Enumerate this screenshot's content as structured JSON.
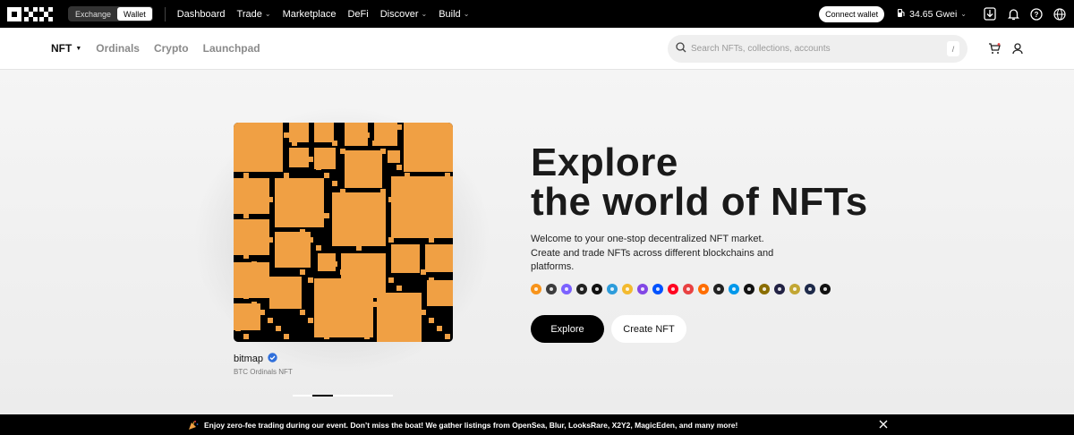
{
  "topbar": {
    "brand": "OKX",
    "mode_tabs": [
      "Exchange",
      "Wallet"
    ],
    "active_mode": "Wallet",
    "nav": [
      {
        "label": "Dashboard",
        "dropdown": false
      },
      {
        "label": "Trade",
        "dropdown": true
      },
      {
        "label": "Marketplace",
        "dropdown": false
      },
      {
        "label": "DeFi",
        "dropdown": false
      },
      {
        "label": "Discover",
        "dropdown": true
      },
      {
        "label": "Build",
        "dropdown": true
      }
    ],
    "connect_label": "Connect wallet",
    "gas_label": "34.65 Gwei",
    "icons": [
      "download-icon",
      "bell-icon",
      "help-icon",
      "globe-icon"
    ]
  },
  "subnav": {
    "tabs": [
      "NFT",
      "Ordinals",
      "Crypto",
      "Launchpad"
    ],
    "current": "NFT",
    "search_placeholder": "Search NFTs, collections, accounts",
    "search_shortcut": "/",
    "icons": [
      "cart-icon",
      "user-icon"
    ]
  },
  "hero": {
    "title_line1": "Explore",
    "title_line2": "the world of NFTs",
    "description": "Welcome to your one-stop decentralized NFT market. Create and trade NFTs across different blockchains and platforms.",
    "explore_label": "Explore",
    "create_label": "Create NFT",
    "collection_name": "bitmap",
    "collection_subtitle": "BTC Ordinals NFT",
    "verified": true,
    "art_colors": {
      "fill": "#f0a044",
      "grid": "#111111"
    },
    "carousel_count": 5,
    "carousel_active": 1,
    "chain_icons": [
      {
        "name": "bitcoin-icon",
        "color": "#f7931a"
      },
      {
        "name": "ethereum-icon",
        "color": "#3c3c3d"
      },
      {
        "name": "solana-icon",
        "color": "#7b61ff"
      },
      {
        "name": "okt-chain-icon",
        "color": "#222222"
      },
      {
        "name": "x-layer-icon",
        "color": "#111111"
      },
      {
        "name": "arbitrum-icon",
        "color": "#2d9cdb"
      },
      {
        "name": "bnb-chain-icon",
        "color": "#f3ba2f"
      },
      {
        "name": "polygon-icon",
        "color": "#8247e5"
      },
      {
        "name": "base-icon",
        "color": "#0052ff"
      },
      {
        "name": "optimism-icon",
        "color": "#ff0420"
      },
      {
        "name": "avalanche-icon",
        "color": "#e84142"
      },
      {
        "name": "ordi-icon",
        "color": "#ff6d00"
      },
      {
        "name": "dots-icon",
        "color": "#222222"
      },
      {
        "name": "ton-icon",
        "color": "#0098ea"
      },
      {
        "name": "linea-icon",
        "color": "#121212"
      },
      {
        "name": "blast-icon",
        "color": "#8a6d00"
      },
      {
        "name": "mantle-icon",
        "color": "#222244"
      },
      {
        "name": "doge-icon",
        "color": "#c2a633"
      },
      {
        "name": "eth-classic-icon",
        "color": "#1e2a4a"
      },
      {
        "name": "zksync-icon",
        "color": "#111111"
      }
    ]
  },
  "banner": {
    "text": "Enjoy zero-fee trading during our event. Don’t miss the boat! We gather listings from OpenSea, Blur, LooksRare, X2Y2, MagicEden, and many more!"
  }
}
